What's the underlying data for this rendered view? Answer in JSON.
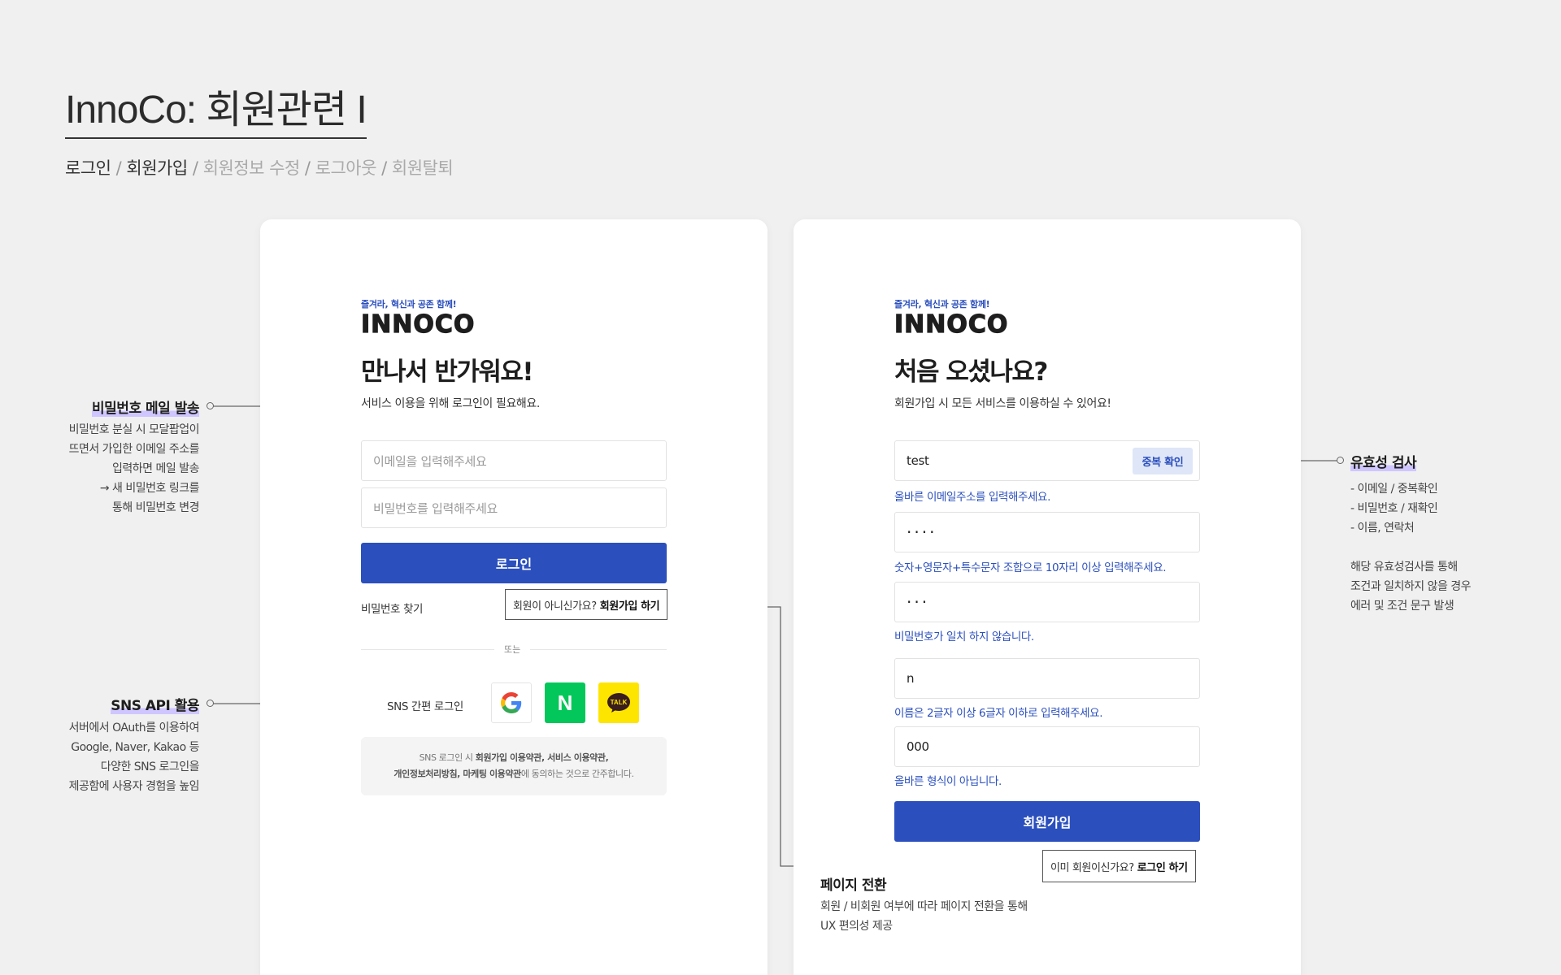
{
  "header": {
    "title": "InnoCo: 회원관련 I",
    "breadcrumb_active_1": "로그인",
    "breadcrumb_sep": " / ",
    "breadcrumb_active_2": "회원가입",
    "breadcrumb_inactive": [
      "회원정보 수정",
      "로그아웃",
      "회원탈퇴"
    ]
  },
  "brand": {
    "slogan": "즐겨라, 혁신과 공존 함께!",
    "logo": "INNOCO",
    "accent_color": "#2b4fbd"
  },
  "login": {
    "heading": "만나서 반가워요!",
    "subheading": "서비스 이용을 위해 로그인이 필요해요.",
    "email_placeholder": "이메일을 입력해주세요",
    "password_placeholder": "비밀번호를 입력해주세요",
    "login_button": "로그인",
    "find_password": "비밀번호 찾기",
    "signup_prompt": "회원이 아니신가요?",
    "signup_link": "회원가입 하기",
    "divider": "또는",
    "sns_label": "SNS 간편 로그인",
    "sns_icons": [
      "google-icon",
      "naver-icon",
      "kakao-talk-icon"
    ],
    "naver_letter": "N",
    "kakao_text": "TALK",
    "terms_line1_prefix": "SNS 로그인 시 ",
    "terms_line1_bold": "회원가입 이용약관, 서비스 이용약관,",
    "terms_line2_bold": "개인정보처리방침, 마케팅 이용약관",
    "terms_line2_suffix": "에 동의하는 것으로 간주합니다."
  },
  "signup": {
    "heading": "처음 오셨나요?",
    "subheading": "회원가입 시 모든 서비스를 이용하실 수 있어요!",
    "email_value": "test",
    "dup_check": "중복 확인",
    "email_hint": "올바른 이메일주소를 입력해주세요.",
    "password_value": "····",
    "password_hint": "숫자+영문자+특수문자 조합으로 10자리 이상 입력해주세요.",
    "confirm_value": "···",
    "confirm_hint": "비밀번호가 일치 하지 않습니다.",
    "name_value": "n",
    "name_hint": "이름은 2글자 이상 6글자 이하로 입력해주세요.",
    "phone_value": "000",
    "phone_hint": "올바른 형식이 아닙니다.",
    "signup_button": "회원가입",
    "login_prompt": "이미 회원이신가요?",
    "login_link": "로그인 하기"
  },
  "annotations": {
    "password_mail": {
      "title": "비밀번호 메일 발송",
      "lines": [
        "비밀번호 분실 시 모달팝업이",
        "뜨면서 가입한 이메일 주소를",
        "입력하면 메일 발송",
        "→ 새 비밀번호 링크를",
        "통해 비밀번호 변경"
      ]
    },
    "sns_api": {
      "title": "SNS API 활용",
      "lines": [
        "서버에서 OAuth를 이용하여",
        "Google, Naver, Kakao 등",
        "다양한 SNS 로그인을",
        "제공함에 사용자 경험을 높임"
      ]
    },
    "validation": {
      "title": "유효성 검사",
      "lines": [
        "- 이메일 / 중복확인",
        "- 비밀번호 / 재확인",
        "- 이름, 연락처",
        "",
        "해당 유효성검사를 통해",
        "조건과 일치하지 않을 경우",
        "에러 및 조건 문구 발생"
      ]
    },
    "page_switch": {
      "title": "페이지 전환",
      "lines": [
        "회원 / 비회원 여부에 따라 페이지 전환을 통해",
        "UX 편의성 제공"
      ]
    }
  }
}
